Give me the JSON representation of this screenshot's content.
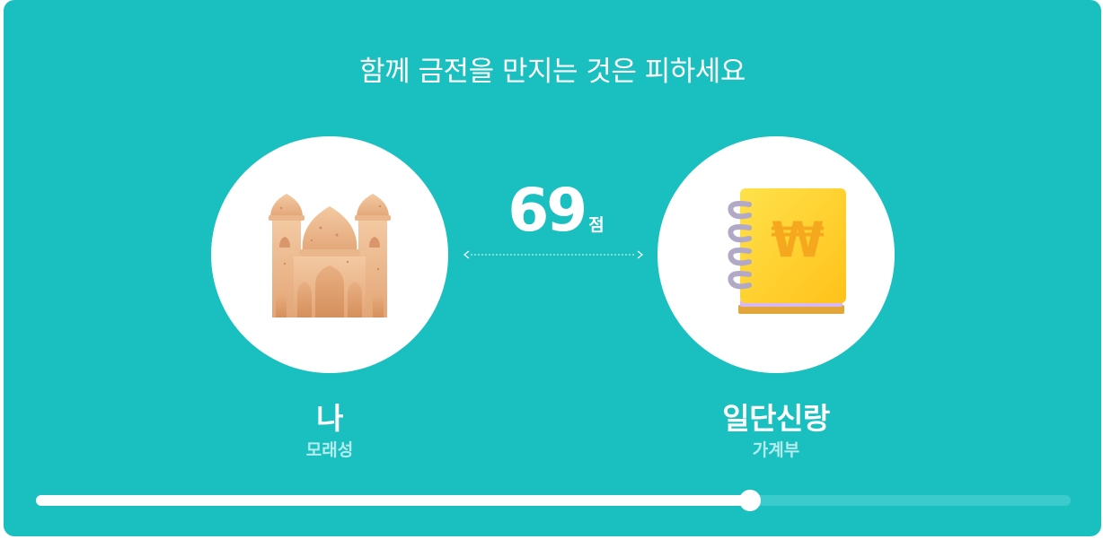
{
  "headline": "함께 금전을 만지는 것은 피하세요",
  "score": {
    "value": "69",
    "unit": "점"
  },
  "left_person": {
    "name": "나",
    "subtitle": "모래성",
    "icon": "sandcastle-icon"
  },
  "right_person": {
    "name": "일단신랑",
    "subtitle": "가계부",
    "icon": "ledger-book-icon"
  },
  "compatibility_slider": {
    "level_percent": 69
  },
  "colors": {
    "background": "#1abfc0",
    "track": "#3ccbcc",
    "fill": "#ffffff",
    "subtitle": "#b4ecec"
  }
}
